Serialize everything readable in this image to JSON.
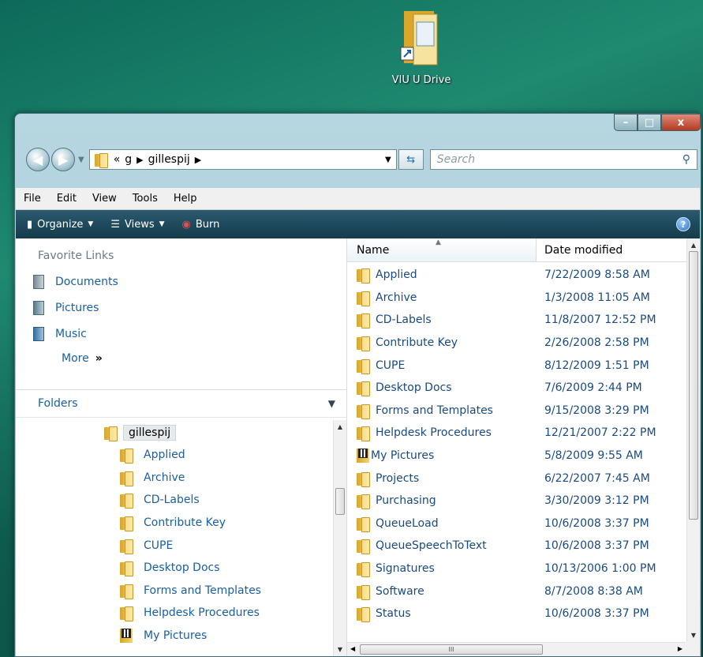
{
  "desktop": {
    "icon_label": "VIU U Drive"
  },
  "window": {
    "controls": {
      "minimize": "–",
      "maximize": "□",
      "close": "x"
    },
    "address": {
      "prefix": "«",
      "crumbs": [
        "g",
        "gillespij"
      ],
      "search_placeholder": "Search"
    },
    "menu": [
      "File",
      "Edit",
      "View",
      "Tools",
      "Help"
    ],
    "toolbar": {
      "organize": "Organize",
      "views": "Views",
      "burn": "Burn",
      "help": "?"
    },
    "favorites": {
      "header": "Favorite Links",
      "items": [
        "Documents",
        "Pictures",
        "Music"
      ],
      "more": "More",
      "more_chevron": "»"
    },
    "folders_header": "Folders",
    "tree": {
      "root": "gillespij",
      "items": [
        "Applied",
        "Archive",
        "CD-Labels",
        "Contribute Key",
        "CUPE",
        "Desktop Docs",
        "Forms and Templates",
        "Helpdesk Procedures",
        "My Pictures"
      ]
    },
    "list": {
      "columns": {
        "name": "Name",
        "date": "Date modified"
      },
      "rows": [
        {
          "name": "Applied",
          "date": "7/22/2009 8:58 AM"
        },
        {
          "name": "Archive",
          "date": "1/3/2008 11:05 AM"
        },
        {
          "name": "CD-Labels",
          "date": "11/8/2007 12:52 PM"
        },
        {
          "name": "Contribute Key",
          "date": "2/26/2008 2:58 PM"
        },
        {
          "name": "CUPE",
          "date": "8/12/2009 1:51 PM"
        },
        {
          "name": "Desktop Docs",
          "date": "7/6/2009 2:44 PM"
        },
        {
          "name": "Forms and Templates",
          "date": "9/15/2008 3:29 PM"
        },
        {
          "name": "Helpdesk Procedures",
          "date": "12/21/2007 2:22 PM"
        },
        {
          "name": "My Pictures",
          "date": "5/8/2009 9:55 AM"
        },
        {
          "name": "Projects",
          "date": "6/22/2007 7:45 AM"
        },
        {
          "name": "Purchasing",
          "date": "3/30/2009 3:12 PM"
        },
        {
          "name": "QueueLoad",
          "date": "10/6/2008 3:37 PM"
        },
        {
          "name": "QueueSpeechToText",
          "date": "10/6/2008 3:37 PM"
        },
        {
          "name": "Signatures",
          "date": "10/13/2006 1:00 PM"
        },
        {
          "name": "Software",
          "date": "8/7/2008 8:38 AM"
        },
        {
          "name": "Status",
          "date": "10/6/2008 3:37 PM"
        }
      ]
    }
  }
}
